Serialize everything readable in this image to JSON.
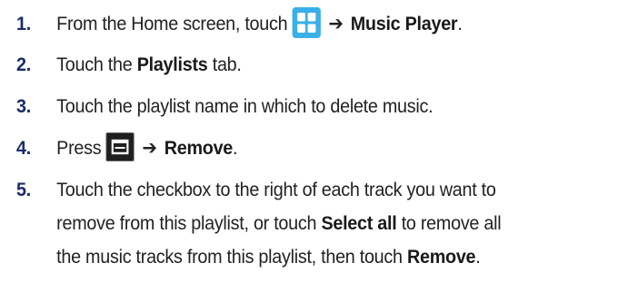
{
  "steps": [
    {
      "number": "1.",
      "text_before": "From the Home screen, touch",
      "icon": "apps-grid-icon",
      "arrow": "➔",
      "bold": "Music Player",
      "text_after": "."
    },
    {
      "number": "2.",
      "text_before": "Touch the",
      "bold": "Playlists",
      "text_after": "tab."
    },
    {
      "number": "3.",
      "text": "Touch the playlist name in which to delete music."
    },
    {
      "number": "4.",
      "text_before": "Press",
      "icon": "menu-key-icon",
      "arrow": "➔",
      "bold": "Remove",
      "text_after": "."
    },
    {
      "number": "5.",
      "line1": "Touch the checkbox to the right of each track you want to",
      "line2_before": "remove from this playlist, or touch",
      "line2_bold": "Select all",
      "line2_after": "to remove all",
      "line3_before": "the music tracks from this playlist, then touch",
      "line3_bold": "Remove",
      "line3_after": "."
    }
  ],
  "colors": {
    "step_number": "#1a2b6b",
    "apps_icon_bg": "#3ab0e8",
    "menu_icon_bg": "#1f1f1f"
  }
}
